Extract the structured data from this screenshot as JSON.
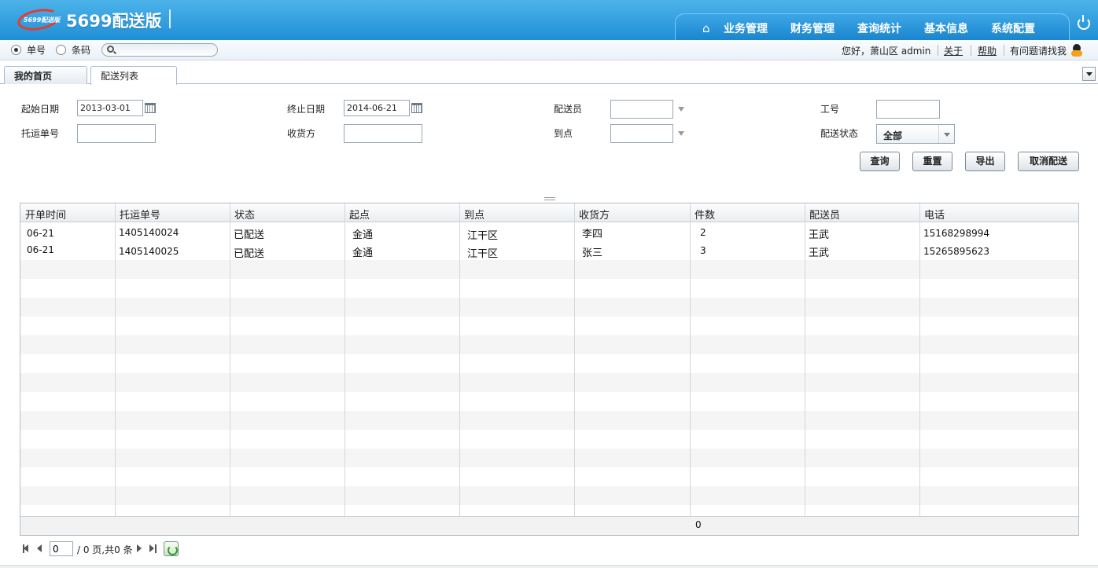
{
  "header": {
    "logo_text": "5699配送版",
    "app_title": "5699配送版",
    "nav": [
      "业务管理",
      "财务管理",
      "查询统计",
      "基本信息",
      "系统配置"
    ]
  },
  "searchbar": {
    "radio_waybill": "单号",
    "radio_barcode": "条码",
    "search_placeholder": "",
    "greeting": "您好，萧山区 admin",
    "about": "关于",
    "help": "帮助",
    "contact": "有问题请找我"
  },
  "tabs": [
    "我的首页",
    "配送列表"
  ],
  "form": {
    "start_date_label": "起始日期",
    "start_date": "2013-03-01",
    "end_date_label": "终止日期",
    "end_date": "2014-06-21",
    "courier_label": "配送员",
    "staff_no_label": "工号",
    "waybill_label": "托运单号",
    "receiver_label": "收货方",
    "destination_label": "到点",
    "status_label": "配送状态",
    "status_value": "全部",
    "buttons": {
      "query": "查询",
      "reset": "重置",
      "export": "导出",
      "cancel": "取消配送"
    }
  },
  "grid": {
    "columns": [
      "开单时间",
      "托运单号",
      "状态",
      "起点",
      "到点",
      "收货方",
      "件数",
      "配送员",
      "电话"
    ],
    "rows": [
      [
        "06-21",
        "1405140024",
        "已配送",
        "金通",
        "江干区",
        "李四",
        "2",
        "王武",
        "15168298994"
      ],
      [
        "06-21",
        "1405140025",
        "已配送",
        "金通",
        "江干区",
        "张三",
        "3",
        "王武",
        "15265895623"
      ]
    ],
    "footer_total": "0"
  },
  "pager": {
    "page": "0",
    "summary": "/ 0 页,共0 条"
  },
  "colors": {
    "header_top": "#4db3ea",
    "header_bottom": "#1f8fd6",
    "logo_red": "#e53b2e"
  }
}
